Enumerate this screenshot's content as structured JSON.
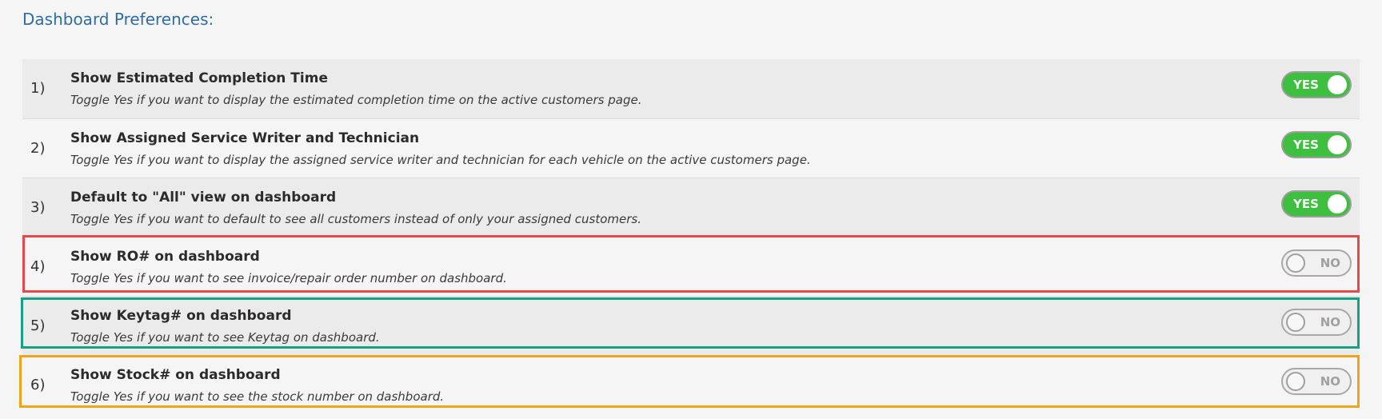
{
  "section": {
    "title": "Dashboard Preferences:"
  },
  "preferences": [
    {
      "number": "1)",
      "title": "Show Estimated Completion Time",
      "description": "Toggle Yes if you want to display the estimated completion time on the active customers page.",
      "toggle_label": "YES",
      "enabled": true
    },
    {
      "number": "2)",
      "title": "Show Assigned Service Writer and Technician",
      "description": "Toggle Yes if you want to display the assigned service writer and technician for each vehicle on the active customers page.",
      "toggle_label": "YES",
      "enabled": true
    },
    {
      "number": "3)",
      "title": "Default to \"All\" view on dashboard",
      "description": "Toggle Yes if you want to default to see all customers instead of only your assigned customers.",
      "toggle_label": "YES",
      "enabled": true
    },
    {
      "number": "4)",
      "title": "Show RO# on dashboard",
      "description": "Toggle Yes if you want to see invoice/repair order number on dashboard.",
      "toggle_label": "NO",
      "enabled": false
    },
    {
      "number": "5)",
      "title": "Show Keytag# on dashboard",
      "description": "Toggle Yes if you want to see Keytag on dashboard.",
      "toggle_label": "NO",
      "enabled": false
    },
    {
      "number": "6)",
      "title": "Show Stock# on dashboard",
      "description": "Toggle Yes if you want to see the stock number on dashboard.",
      "toggle_label": "NO",
      "enabled": false
    }
  ],
  "highlights": [
    {
      "row": 4,
      "color": "#e8474b"
    },
    {
      "row": 5,
      "color": "#17a085"
    },
    {
      "row": 6,
      "color": "#f0a21b"
    }
  ],
  "colors": {
    "title": "#2e6da4",
    "toggle_on": "#3fbf3f",
    "toggle_off": "#f0f0f0"
  }
}
